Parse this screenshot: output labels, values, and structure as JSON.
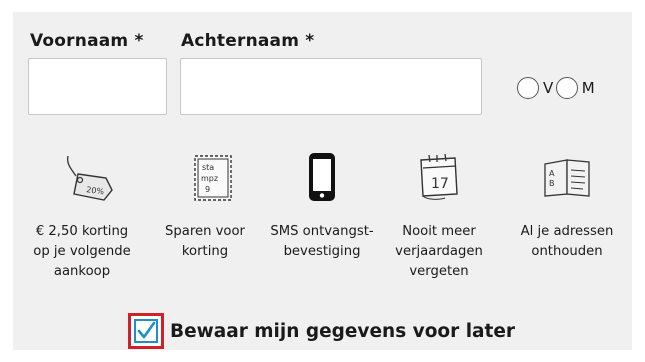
{
  "form": {
    "first_name_label": "Voornaam *",
    "last_name_label": "Achternaam *",
    "first_name_value": "",
    "last_name_value": "",
    "gender_options": [
      "V",
      "M"
    ],
    "gender_selected": ""
  },
  "benefits": [
    {
      "icon": "price-tag-icon",
      "lines": [
        "€ 2,50 korting",
        "op je volgende",
        "aankoop"
      ]
    },
    {
      "icon": "stamp-card-icon",
      "lines": [
        "Sparen voor",
        "korting"
      ]
    },
    {
      "icon": "mobile-phone-icon",
      "lines": [
        "SMS ontvangst-",
        "bevestiging"
      ]
    },
    {
      "icon": "calendar-icon",
      "lines": [
        "Nooit meer",
        "verjaardagen",
        "vergeten"
      ]
    },
    {
      "icon": "address-book-icon",
      "lines": [
        "Al je adressen",
        "onthouden"
      ]
    }
  ],
  "save": {
    "label": "Bewaar mijn gegevens voor later",
    "checked": true
  },
  "colors": {
    "panel_bg": "#f0f0f0",
    "checkbox_highlight": "#d0202a",
    "checkmark": "#1e8fc8"
  }
}
